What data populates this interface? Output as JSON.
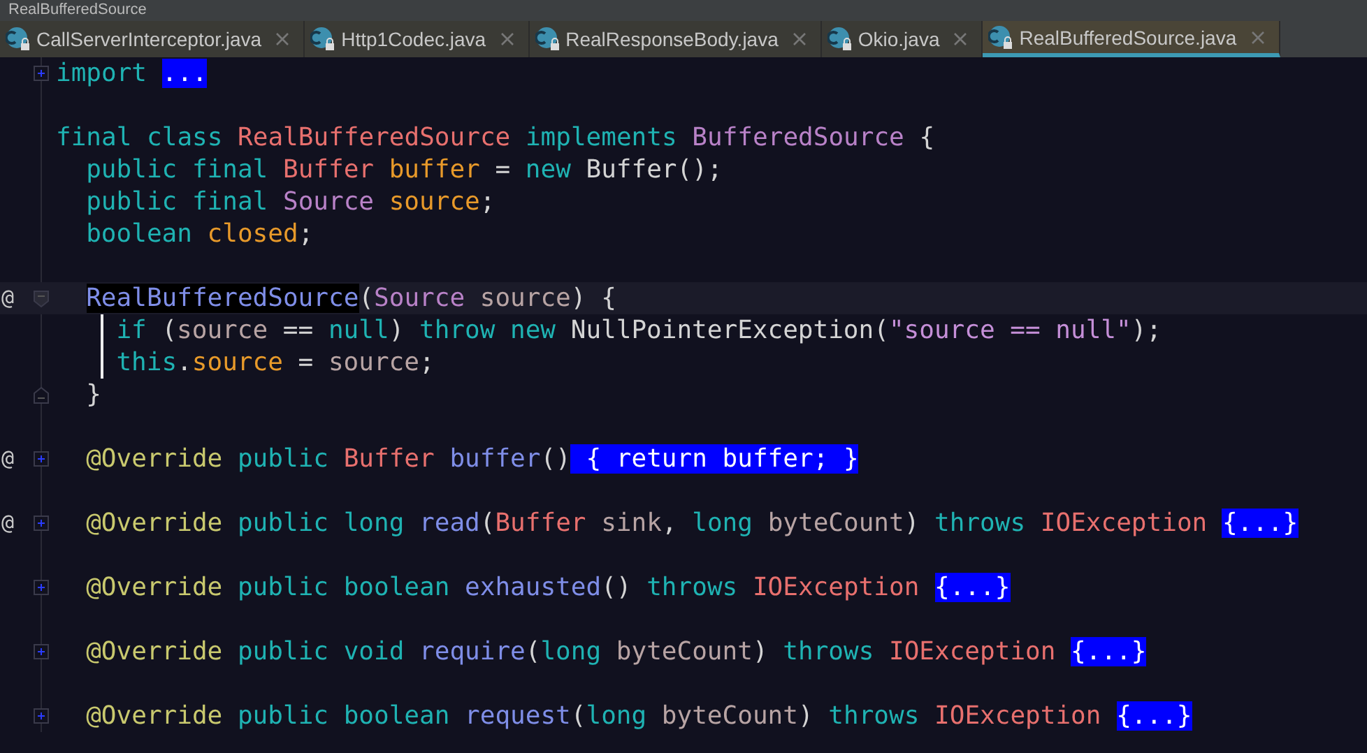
{
  "breadcrumb": "RealBufferedSource",
  "tabs": [
    {
      "label": "CallServerInterceptor.java",
      "selected": false
    },
    {
      "label": "Http1Codec.java",
      "selected": false
    },
    {
      "label": "RealResponseBody.java",
      "selected": false
    },
    {
      "label": "Okio.java",
      "selected": false
    },
    {
      "label": "RealBufferedSource.java",
      "selected": true
    }
  ],
  "lines": [
    {
      "kind": "code",
      "current": false,
      "collapsed": true,
      "tokens": [
        {
          "kind": "kw",
          "text": "import "
        }
      ],
      "folded": "..."
    },
    {
      "kind": "blank"
    },
    {
      "kind": "code",
      "current": false,
      "scope_bar": false,
      "tokens": [
        {
          "kind": "kw",
          "text": "final class "
        },
        {
          "kind": "cls",
          "text": "RealBufferedSource "
        },
        {
          "kind": "kw",
          "text": "implements "
        },
        {
          "kind": "iface",
          "text": "BufferedSource "
        },
        {
          "kind": "plain",
          "text": "{"
        }
      ],
      "children": [
        {
          "kind": "code",
          "current": false,
          "tokens": [
            {
              "kind": "kw",
              "text": "public final "
            },
            {
              "kind": "cls",
              "text": "Buffer "
            },
            {
              "kind": "field",
              "text": "buffer"
            },
            {
              "kind": "plain",
              "text": " = "
            },
            {
              "kind": "kw",
              "text": "new "
            },
            {
              "kind": "plain",
              "text": "Buffer();"
            }
          ]
        },
        {
          "kind": "code",
          "current": false,
          "tokens": [
            {
              "kind": "kw",
              "text": "public final "
            },
            {
              "kind": "iface",
              "text": "Source "
            },
            {
              "kind": "field",
              "text": "source"
            },
            {
              "kind": "plain",
              "text": ";"
            }
          ]
        },
        {
          "kind": "code",
          "current": false,
          "tokens": [
            {
              "kind": "kw",
              "text": "boolean "
            },
            {
              "kind": "field",
              "text": "closed"
            },
            {
              "kind": "plain",
              "text": ";"
            }
          ]
        },
        {
          "kind": "blank"
        },
        {
          "kind": "code",
          "marker": "@",
          "current": true,
          "collapsed": false,
          "scope_bar": true,
          "tokens": [
            {
              "kind": "caret",
              "text": "RealBufferedSource"
            },
            {
              "kind": "plain",
              "text": "("
            },
            {
              "kind": "iface",
              "text": "Source "
            },
            {
              "kind": "param",
              "text": "source"
            },
            {
              "kind": "plain",
              "text": ") {"
            }
          ],
          "children": [
            {
              "kind": "code",
              "current": false,
              "tokens": [
                {
                  "kind": "kw",
                  "text": "if "
                },
                {
                  "kind": "plain",
                  "text": "("
                },
                {
                  "kind": "param",
                  "text": "source"
                },
                {
                  "kind": "plain",
                  "text": " == "
                },
                {
                  "kind": "kw",
                  "text": "null"
                },
                {
                  "kind": "plain",
                  "text": ") "
                },
                {
                  "kind": "kw",
                  "text": "throw new "
                },
                {
                  "kind": "plain",
                  "text": "NullPointerException("
                },
                {
                  "kind": "str",
                  "text": "\"source == null\""
                },
                {
                  "kind": "plain",
                  "text": ");"
                }
              ]
            },
            {
              "kind": "code",
              "current": false,
              "tokens": [
                {
                  "kind": "kw",
                  "text": "this"
                },
                {
                  "kind": "plain",
                  "text": "."
                },
                {
                  "kind": "field",
                  "text": "source"
                },
                {
                  "kind": "plain",
                  "text": " = "
                },
                {
                  "kind": "param",
                  "text": "source"
                },
                {
                  "kind": "plain",
                  "text": ";"
                }
              ]
            }
          ],
          "closing": "}"
        },
        {
          "kind": "blank"
        },
        {
          "kind": "code",
          "marker": "@",
          "current": false,
          "collapsed": true,
          "tokens": [
            {
              "kind": "anno",
              "text": "@Override "
            },
            {
              "kind": "kw",
              "text": "public "
            },
            {
              "kind": "cls",
              "text": "Buffer "
            },
            {
              "kind": "method",
              "text": "buffer"
            },
            {
              "kind": "plain",
              "text": "()"
            }
          ],
          "folded": " { return buffer; }"
        },
        {
          "kind": "blank"
        },
        {
          "kind": "code",
          "marker": "@",
          "current": false,
          "collapsed": true,
          "tokens": [
            {
              "kind": "anno",
              "text": "@Override "
            },
            {
              "kind": "kw",
              "text": "public long "
            },
            {
              "kind": "method",
              "text": "read"
            },
            {
              "kind": "plain",
              "text": "("
            },
            {
              "kind": "cls",
              "text": "Buffer "
            },
            {
              "kind": "param",
              "text": "sink"
            },
            {
              "kind": "plain",
              "text": ", "
            },
            {
              "kind": "kw",
              "text": "long "
            },
            {
              "kind": "param",
              "text": "byteCount"
            },
            {
              "kind": "plain",
              "text": ") "
            },
            {
              "kind": "kw",
              "text": "throws "
            },
            {
              "kind": "cls",
              "text": "IOException "
            }
          ],
          "folded": "{...}"
        },
        {
          "kind": "blank"
        },
        {
          "kind": "code",
          "current": false,
          "collapsed": true,
          "tokens": [
            {
              "kind": "anno",
              "text": "@Override "
            },
            {
              "kind": "kw",
              "text": "public boolean "
            },
            {
              "kind": "method",
              "text": "exhausted"
            },
            {
              "kind": "plain",
              "text": "() "
            },
            {
              "kind": "kw",
              "text": "throws "
            },
            {
              "kind": "cls",
              "text": "IOException "
            }
          ],
          "folded": "{...}"
        },
        {
          "kind": "blank"
        },
        {
          "kind": "code",
          "current": false,
          "collapsed": true,
          "tokens": [
            {
              "kind": "anno",
              "text": "@Override "
            },
            {
              "kind": "kw",
              "text": "public void "
            },
            {
              "kind": "method",
              "text": "require"
            },
            {
              "kind": "plain",
              "text": "("
            },
            {
              "kind": "kw",
              "text": "long "
            },
            {
              "kind": "param",
              "text": "byteCount"
            },
            {
              "kind": "plain",
              "text": ") "
            },
            {
              "kind": "kw",
              "text": "throws "
            },
            {
              "kind": "cls",
              "text": "IOException "
            }
          ],
          "folded": "{...}"
        },
        {
          "kind": "blank"
        },
        {
          "kind": "code",
          "current": false,
          "collapsed": true,
          "tokens": [
            {
              "kind": "anno",
              "text": "@Override "
            },
            {
              "kind": "kw",
              "text": "public boolean "
            },
            {
              "kind": "method",
              "text": "request"
            },
            {
              "kind": "plain",
              "text": "("
            },
            {
              "kind": "kw",
              "text": "long "
            },
            {
              "kind": "param",
              "text": "byteCount"
            },
            {
              "kind": "plain",
              "text": ") "
            },
            {
              "kind": "kw",
              "text": "throws "
            },
            {
              "kind": "cls",
              "text": "IOException "
            }
          ],
          "folded": "{...}"
        }
      ]
    }
  ]
}
